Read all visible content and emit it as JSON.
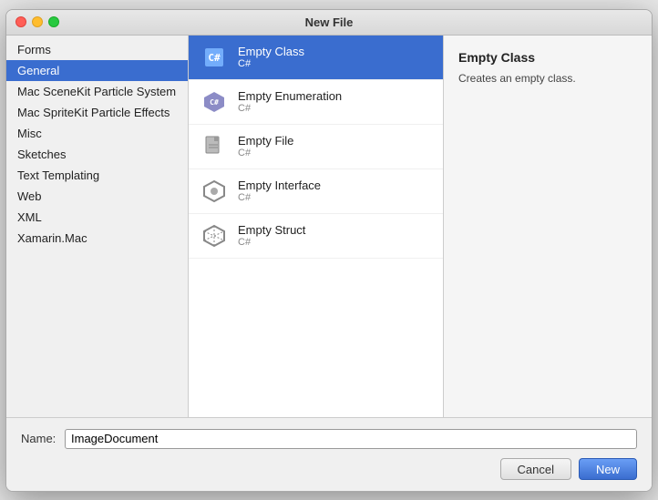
{
  "titlebar": {
    "title": "New File"
  },
  "sidebar": {
    "items": [
      {
        "id": "forms",
        "label": "Forms"
      },
      {
        "id": "general",
        "label": "General",
        "active": true
      },
      {
        "id": "mac-scenekit",
        "label": "Mac SceneKit Particle System"
      },
      {
        "id": "mac-spritekit",
        "label": "Mac SpriteKit Particle Effects"
      },
      {
        "id": "misc",
        "label": "Misc"
      },
      {
        "id": "sketches",
        "label": "Sketches"
      },
      {
        "id": "text-templating",
        "label": "Text Templating"
      },
      {
        "id": "web",
        "label": "Web"
      },
      {
        "id": "xml",
        "label": "XML"
      },
      {
        "id": "xamarin-mac",
        "label": "Xamarin.Mac"
      }
    ]
  },
  "file_list": {
    "items": [
      {
        "id": "empty-class",
        "name": "Empty Class",
        "sub": "C#",
        "active": true,
        "icon": "class"
      },
      {
        "id": "empty-enumeration",
        "name": "Empty Enumeration",
        "sub": "C#",
        "active": false,
        "icon": "enum"
      },
      {
        "id": "empty-file",
        "name": "Empty File",
        "sub": "C#",
        "active": false,
        "icon": "file"
      },
      {
        "id": "empty-interface",
        "name": "Empty Interface",
        "sub": "C#",
        "active": false,
        "icon": "interface"
      },
      {
        "id": "empty-struct",
        "name": "Empty Struct",
        "sub": "C#",
        "active": false,
        "icon": "struct"
      }
    ]
  },
  "detail": {
    "title": "Empty Class",
    "description": "Creates an empty class."
  },
  "bottom": {
    "name_label": "Name:",
    "name_value": "ImageDocument",
    "name_placeholder": "ImageDocument",
    "cancel_label": "Cancel",
    "new_label": "New"
  }
}
